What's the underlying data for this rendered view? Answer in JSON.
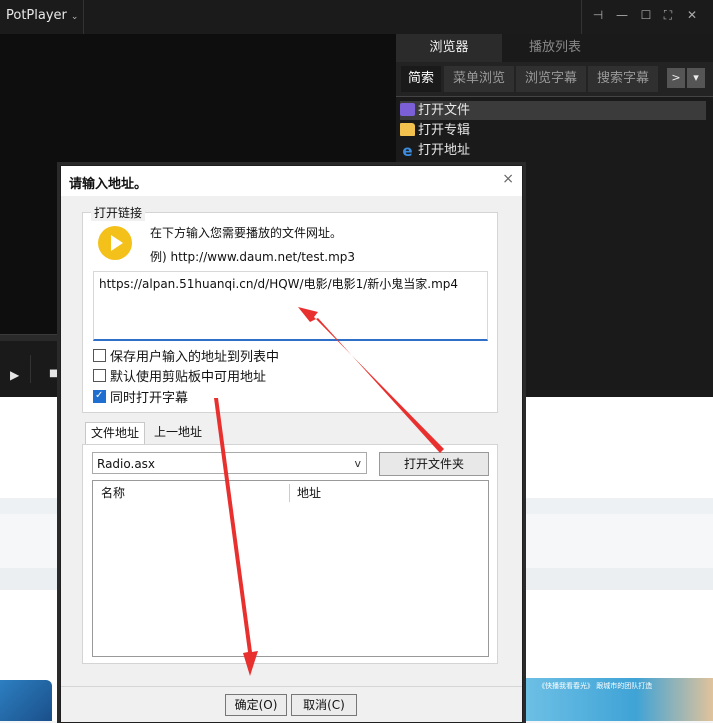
{
  "potplayer": {
    "app_name": "PotPlayer",
    "menu_caret": "⌄",
    "controls": {
      "pin": "⊣",
      "minimize": "—",
      "maximize": "☐",
      "fullscreen": "⛶",
      "close": "✕"
    },
    "main_tabs": [
      {
        "label": "浏览器",
        "active": true
      },
      {
        "label": "播放列表",
        "active": false
      }
    ],
    "sub_tabs": [
      {
        "label": "简索",
        "active": true
      },
      {
        "label": "菜单浏览",
        "active": false
      },
      {
        "label": "浏览字幕",
        "active": false
      },
      {
        "label": "搜索字幕",
        "active": false
      }
    ],
    "sub_arrows": [
      ">",
      "▾"
    ],
    "playlist_items": [
      {
        "label": "打开文件",
        "icon": "video-file-icon",
        "selected": true
      },
      {
        "label": "打开专辑",
        "icon": "folder-icon",
        "selected": false
      },
      {
        "label": "打开地址",
        "icon": "ie-globe-icon",
        "selected": false
      }
    ],
    "play_glyph": "▶",
    "stop_glyph": "■"
  },
  "dialog": {
    "title": "请输入地址。",
    "close": "×",
    "group_label": "打开链接",
    "instruction": "在下方输入您需要播放的文件网址。",
    "example": "例) http://www.daum.net/test.mp3",
    "url_value": "https://alpan.51huanqi.cn/d/HQW/电影/电影1/新小鬼当家.mp4",
    "checkboxes": [
      {
        "label": "保存用户输入的地址到列表中",
        "checked": false
      },
      {
        "label": "默认使用剪贴板中可用地址",
        "checked": false
      },
      {
        "label": "同时打开字幕",
        "checked": true
      }
    ],
    "tabs": [
      {
        "label": "文件地址",
        "active": true
      },
      {
        "label": "上一地址",
        "active": false
      }
    ],
    "select_value": "Radio.asx",
    "select_arrow": "v",
    "open_folder_button": "打开文件夹",
    "columns": [
      "名称",
      "地址"
    ],
    "ok_button": "确定(O)",
    "cancel_button": "取消(C)"
  },
  "web": {
    "thumb_caption": "《快播我看春光》 跟城市的团队打造"
  },
  "colors": {
    "accent": "#2f6fc7",
    "annotation_red": "#e8312f",
    "play_yellow": "#f3c11a"
  }
}
